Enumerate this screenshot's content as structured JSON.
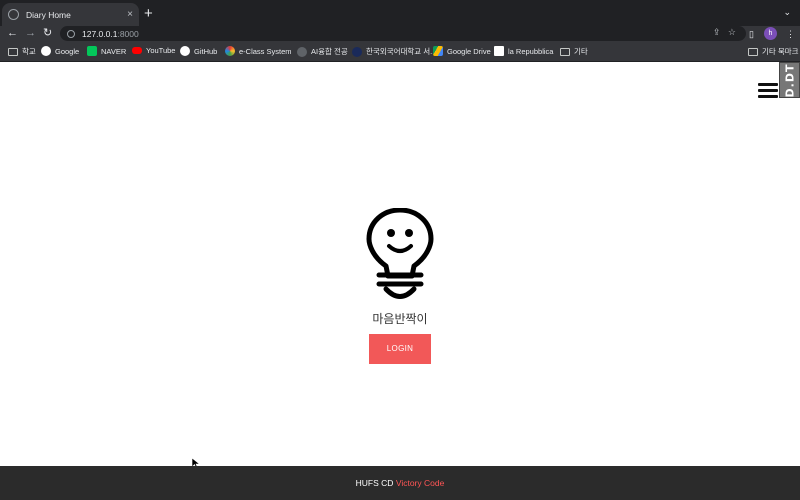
{
  "browser": {
    "tab_title": "Diary Home",
    "tab_close": "×",
    "new_tab": "+",
    "tab_menu": "⌄",
    "url_host": "127.0.0.1",
    "url_port": ":8000",
    "profile_initial": "h",
    "bookmarks": [
      {
        "label": "학교",
        "icon": "folder-icon"
      },
      {
        "label": "Google",
        "icon": "google-icon"
      },
      {
        "label": "NAVER",
        "icon": "naver-icon"
      },
      {
        "label": "YouTube",
        "icon": "youtube-icon"
      },
      {
        "label": "GitHub",
        "icon": "github-icon"
      },
      {
        "label": "e-Class System",
        "icon": "eclass-icon"
      },
      {
        "label": "AI융합 전공",
        "icon": "globe-icon"
      },
      {
        "label": "한국외국어대학교 서...",
        "icon": "hufs-icon"
      },
      {
        "label": "Google Drive",
        "icon": "drive-icon"
      },
      {
        "label": "la Repubblica",
        "icon": "repubblica-icon"
      },
      {
        "label": "기타",
        "icon": "folder-icon"
      }
    ],
    "other_bookmarks": "기타 북마크"
  },
  "page": {
    "side_tab": "D.DT",
    "app_name": "마음반짝이",
    "login_label": "LOGIN"
  },
  "footer": {
    "org": "HUFS CD",
    "team": "Victory Code"
  },
  "colors": {
    "accent": "#f25858",
    "footer_bg": "#2b2b2b",
    "footer_highlight": "#ff5555"
  }
}
